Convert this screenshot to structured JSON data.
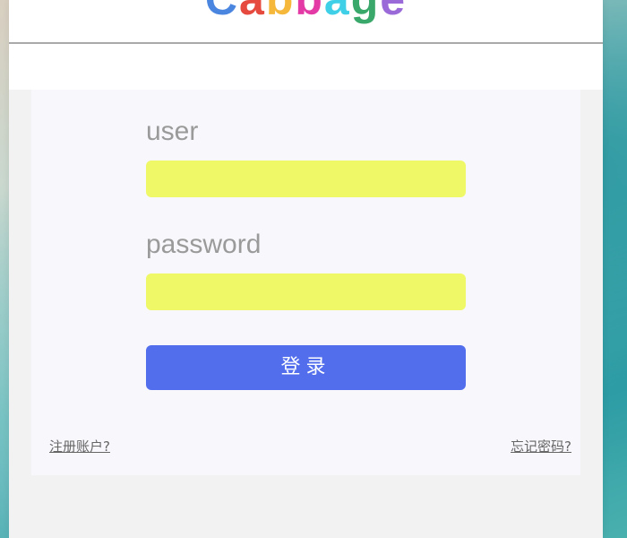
{
  "logo": {
    "letters": [
      {
        "char": "C",
        "color": "#4a86e0"
      },
      {
        "char": "a",
        "color": "#e64a3f"
      },
      {
        "char": "b",
        "color": "#f5b83a"
      },
      {
        "char": "b",
        "color": "#e33aa6"
      },
      {
        "char": "a",
        "color": "#3fd0e8"
      },
      {
        "char": "g",
        "color": "#3aa86b"
      },
      {
        "char": "e",
        "color": "#9a6ad8"
      }
    ]
  },
  "form": {
    "user_label": "user",
    "user_value": "",
    "password_label": "password",
    "password_value": "",
    "login_label": "登录"
  },
  "links": {
    "register": "注册账户?",
    "forgot": "忘记密码?"
  },
  "colors": {
    "input_bg": "#eff866",
    "button_bg": "#526eec",
    "panel_bg": "#f7f7fc"
  }
}
